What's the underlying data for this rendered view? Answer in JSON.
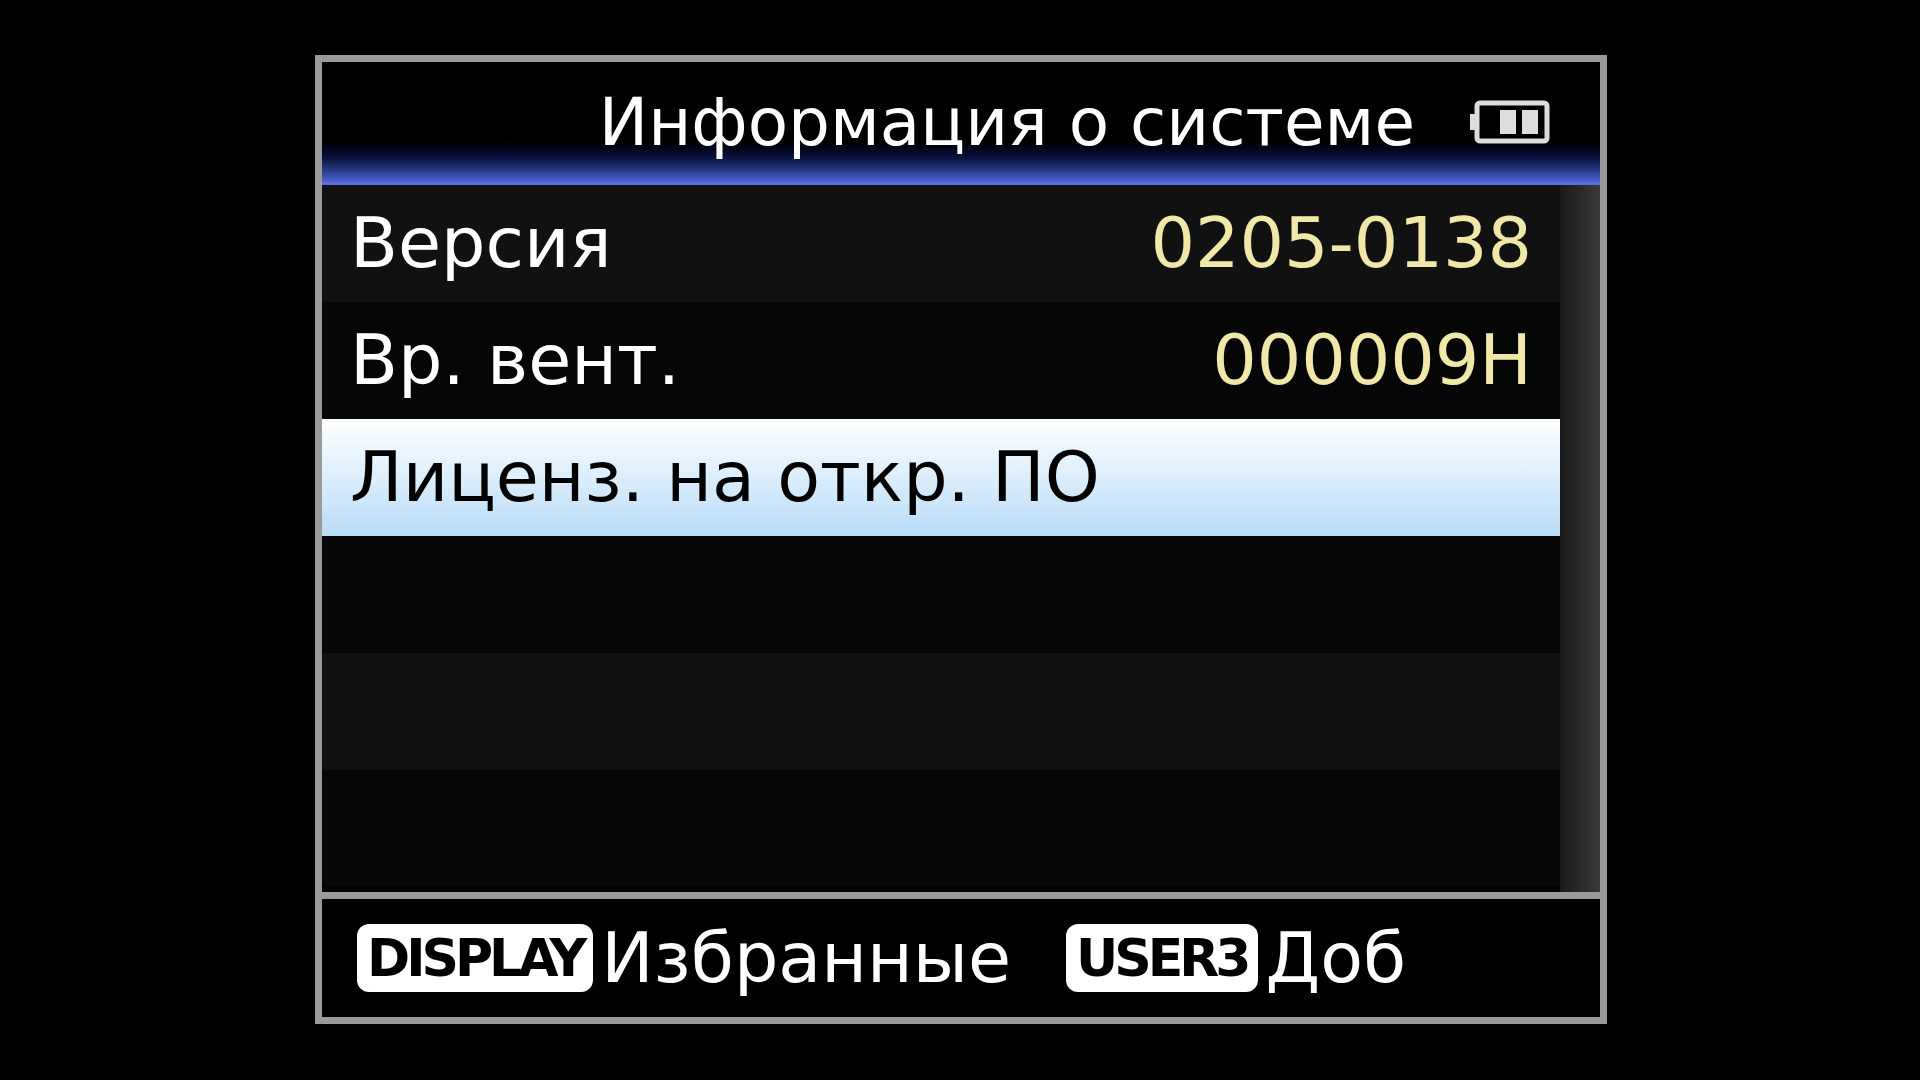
{
  "window": {
    "title": "Информация о системе"
  },
  "rows": [
    {
      "label": "Версия",
      "value": "0205-0138",
      "selected": false
    },
    {
      "label": "Вр. вент.",
      "value": "000009H",
      "selected": false
    },
    {
      "label": "Лиценз. на откр. ПО",
      "selected": true
    }
  ],
  "footer": [
    {
      "key": "DISPLAY",
      "label": "Избранные"
    },
    {
      "key": "USER3",
      "label": "Доб"
    }
  ]
}
